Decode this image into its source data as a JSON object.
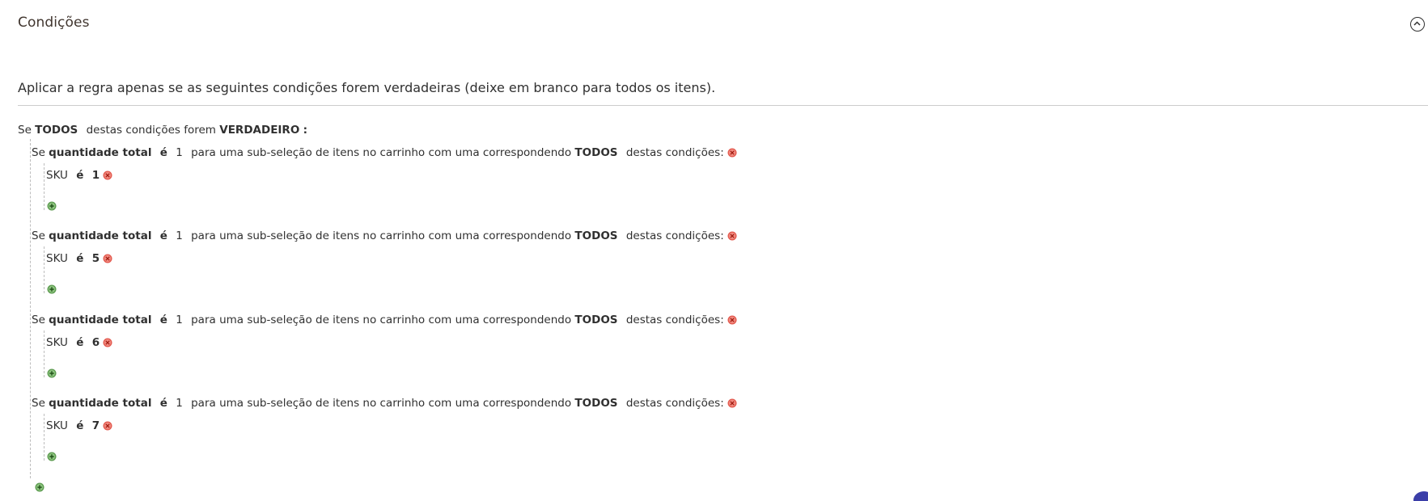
{
  "section": {
    "title": "Condições",
    "collapse_icon": "chevron-up-circle-icon"
  },
  "fieldset": {
    "legend": "Aplicar a regra apenas se as seguintes condições forem verdadeiras (deixe em branco para todos os itens)."
  },
  "root": {
    "prefix": "Se",
    "aggregator": "TODOS",
    "middle": "destas condições forem",
    "value": "VERDADEIRO",
    "suffix": ":"
  },
  "subselect_template": {
    "prefix": "Se",
    "attribute": "quantidade total",
    "operator": "é",
    "middle": "para uma sub-seleção de itens no carrinho com uma correspondendo",
    "aggregator": "TODOS",
    "suffix": "destas condições:"
  },
  "conditions": [
    {
      "qty": "1",
      "sku_label": "SKU",
      "sku_operator": "é",
      "sku_value": "1"
    },
    {
      "qty": "1",
      "sku_label": "SKU",
      "sku_operator": "é",
      "sku_value": "5"
    },
    {
      "qty": "1",
      "sku_label": "SKU",
      "sku_operator": "é",
      "sku_value": "6"
    },
    {
      "qty": "1",
      "sku_label": "SKU",
      "sku_operator": "é",
      "sku_value": "7"
    }
  ],
  "icons": {
    "remove": "remove-circle-icon",
    "add": "add-circle-icon"
  },
  "colors": {
    "remove_red": "#e2574c",
    "add_green": "#5b9a4f",
    "divider": "#cccccc"
  }
}
